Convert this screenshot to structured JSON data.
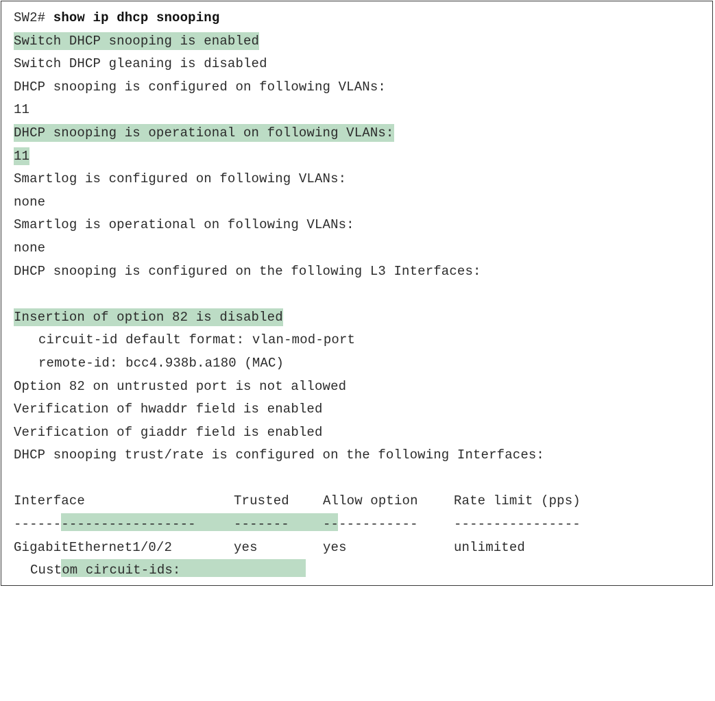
{
  "prompt": "SW2#",
  "command": "show ip dhcp snooping",
  "lines": {
    "l1": "Switch DHCP snooping is enabled",
    "l2": "Switch DHCP gleaning is disabled",
    "l3": "DHCP snooping is configured on following VLANs:",
    "l4": "11",
    "l5": "DHCP snooping is operational on following VLANs:",
    "l6": "11",
    "l7": "Smartlog is configured on following VLANs:",
    "l8": "none",
    "l9": "Smartlog is operational on following VLANs:",
    "l10": "none",
    "l11": "DHCP snooping is configured on the following L3 Interfaces:",
    "l12": "Insertion of option 82 is disabled",
    "l13": "circuit-id default format: vlan-mod-port",
    "l14": "remote-id: bcc4.938b.a180 (MAC)",
    "l15": "Option 82 on untrusted port is not allowed",
    "l16": "Verification of hwaddr field is enabled",
    "l17": "Verification of giaddr field is enabled",
    "l18": "DHCP snooping trust/rate is configured on the following Interfaces:"
  },
  "table": {
    "headers": [
      "Interface",
      "Trusted",
      "Allow option",
      "Rate limit (pps)"
    ],
    "separators": [
      "-----------------------",
      "-------",
      "------------",
      "----------------"
    ],
    "rows": [
      [
        "GigabitEthernet1/0/2",
        "yes",
        "yes",
        "unlimited"
      ]
    ]
  },
  "footer": "Custom circuit-ids:",
  "colors": {
    "highlight": "#bcdcc5",
    "text": "#2b2b2b",
    "border": "#3a3a3a"
  }
}
